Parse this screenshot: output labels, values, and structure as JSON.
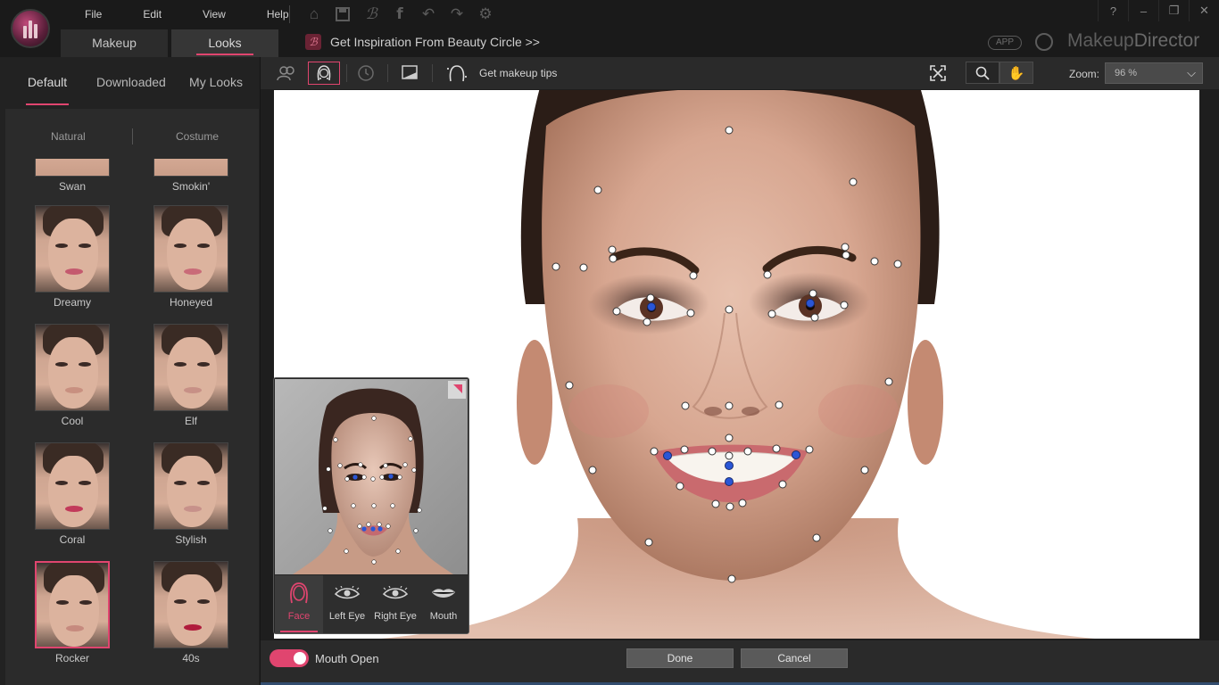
{
  "app": {
    "brand_prefix": "Makeup",
    "brand_suffix": "Director",
    "app_badge": "APP"
  },
  "menu": {
    "file": "File",
    "edit": "Edit",
    "view": "View",
    "help": "Help"
  },
  "tabs": {
    "makeup": "Makeup",
    "looks": "Looks"
  },
  "inspiration": {
    "text": "Get Inspiration From Beauty Circle >>"
  },
  "icons": {
    "home": "home-icon",
    "save": "save-icon",
    "beauty_circle": "beauty-circle-icon",
    "facebook": "facebook-icon",
    "undo": "undo-icon",
    "redo": "redo-icon",
    "settings": "gear-icon",
    "help": "help-icon",
    "minimize": "minimize-icon",
    "restore": "restore-icon",
    "close": "close-icon"
  },
  "colors": {
    "accent": "#e0456f",
    "landmark_blue": "#2a56d6",
    "bg": "#1e1e1e"
  },
  "left_panel": {
    "tabs": [
      "Default",
      "Downloaded",
      "My Looks"
    ],
    "categories": [
      "Natural",
      "Costume"
    ],
    "looks": [
      {
        "name": "Swan",
        "lip": "#c9847a"
      },
      {
        "name": "Smokin'",
        "lip": "#b36a6a"
      },
      {
        "name": "Dreamy",
        "lip": "#c45a6e"
      },
      {
        "name": "Honeyed",
        "lip": "#c96b78"
      },
      {
        "name": "Cool",
        "lip": "#c89080"
      },
      {
        "name": "Elf",
        "lip": "#c79086"
      },
      {
        "name": "Coral",
        "lip": "#c23a5a"
      },
      {
        "name": "Stylish",
        "lip": "#c7918a"
      },
      {
        "name": "Rocker",
        "lip": "#c68a7e"
      },
      {
        "name": "40s",
        "lip": "#b01c3c"
      }
    ]
  },
  "toolbar": {
    "tips_label": "Get makeup tips",
    "zoom_label": "Zoom:",
    "zoom_value": "96 %"
  },
  "mini_panel": {
    "features": [
      "Face",
      "Left Eye",
      "Right Eye",
      "Mouth"
    ]
  },
  "bottom": {
    "mouth_open_label": "Mouth Open",
    "done_label": "Done",
    "cancel_label": "Cancel"
  }
}
